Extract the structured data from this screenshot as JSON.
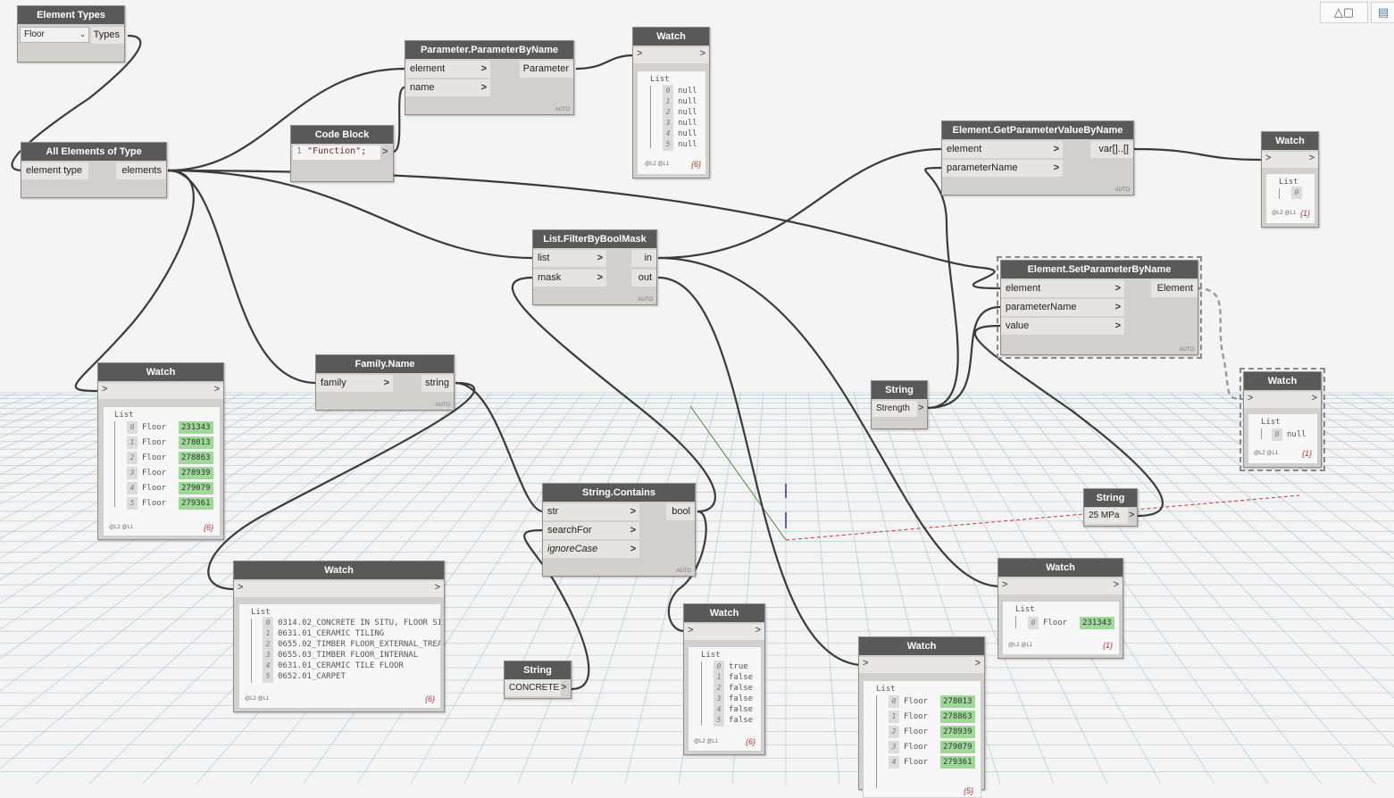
{
  "toolbar": {
    "view_3d_icon": "cube-icon",
    "layout_icon": "layout-icon"
  },
  "colors": {
    "node_header": "#595959",
    "node_body": "#d2d0cc",
    "wire": "#3a3a3a",
    "id_highlight": "#9ed99a",
    "grid": "#a9c3cf"
  },
  "nodes": {
    "element_types": {
      "title": "Element Types",
      "selected": "Floor",
      "output": "Types"
    },
    "all_elements": {
      "title": "All Elements of Type",
      "input": "element type",
      "output": "elements"
    },
    "param_by_name": {
      "title": "Parameter.ParameterByName",
      "in1": "element",
      "in2": "name",
      "output": "Parameter",
      "lacing": "AUTO"
    },
    "code_block": {
      "title": "Code Block",
      "line_no": "1",
      "code": "\"Function\";"
    },
    "watch_top": {
      "title": "Watch",
      "list_label": "List",
      "rows": [
        {
          "i": "0",
          "v": "null"
        },
        {
          "i": "1",
          "v": "null"
        },
        {
          "i": "2",
          "v": "null"
        },
        {
          "i": "3",
          "v": "null"
        },
        {
          "i": "4",
          "v": "null"
        },
        {
          "i": "5",
          "v": "null"
        }
      ],
      "levels": "@L2 @L1",
      "count": "{6}"
    },
    "get_param_value": {
      "title": "Element.GetParameterValueByName",
      "in1": "element",
      "in2": "parameterName",
      "output": "var[]..[]",
      "lacing": "AUTO"
    },
    "watch_right_top": {
      "title": "Watch",
      "list_label": "List",
      "rows": [
        {
          "i": "0",
          "v": ""
        }
      ],
      "levels": "@L2 @L1",
      "count": "{1}"
    },
    "filter_mask": {
      "title": "List.FilterByBoolMask",
      "in1": "list",
      "in2": "mask",
      "out1": "in",
      "out2": "out",
      "lacing": "AUTO"
    },
    "set_param": {
      "title": "Element.SetParameterByName",
      "in1": "element",
      "in2": "parameterName",
      "in3": "value",
      "output": "Element",
      "lacing": "AUTO"
    },
    "watch_left": {
      "title": "Watch",
      "list_label": "List",
      "rows": [
        {
          "i": "0",
          "t": "Floor",
          "id": "231343"
        },
        {
          "i": "1",
          "t": "Floor",
          "id": "278013"
        },
        {
          "i": "2",
          "t": "Floor",
          "id": "278863"
        },
        {
          "i": "3",
          "t": "Floor",
          "id": "278939"
        },
        {
          "i": "4",
          "t": "Floor",
          "id": "279079"
        },
        {
          "i": "5",
          "t": "Floor",
          "id": "279361"
        }
      ],
      "levels": "@L2 @L1",
      "count": "{6}"
    },
    "family_name": {
      "title": "Family.Name",
      "input": "family",
      "output": "string",
      "lacing": "AUTO"
    },
    "string_strength": {
      "title": "String",
      "value": "Strength"
    },
    "watch_null": {
      "title": "Watch",
      "list_label": "List",
      "rows": [
        {
          "i": "0",
          "v": "null"
        }
      ],
      "levels": "@L2 @L1",
      "count": "{1}"
    },
    "string_contains": {
      "title": "String.Contains",
      "in1": "str",
      "in2": "searchFor",
      "in3": "ignoreCase",
      "output": "bool",
      "lacing": "AUTO"
    },
    "string_mpa": {
      "title": "String",
      "value": "25 MPa"
    },
    "watch_names": {
      "title": "Watch",
      "list_label": "List",
      "rows": [
        {
          "i": "0",
          "v": "0314.02_CONCRETE IN SITU, FLOOR SI"
        },
        {
          "i": "1",
          "v": "0631.01_CERAMIC TILING"
        },
        {
          "i": "2",
          "v": "0655.02_TIMBER FLOOR_EXTERNAL_TREA"
        },
        {
          "i": "3",
          "v": "0655.03_TIMBER FLOOR_INTERNAL"
        },
        {
          "i": "4",
          "v": "0631.01_CERAMIC TILE FLOOR"
        },
        {
          "i": "5",
          "v": "0652.01_CARPET"
        }
      ],
      "levels": "@L2 @L1",
      "count": "{6}"
    },
    "string_concrete": {
      "title": "String",
      "value": "CONCRETE"
    },
    "watch_bool": {
      "title": "Watch",
      "list_label": "List",
      "rows": [
        {
          "i": "0",
          "v": "true"
        },
        {
          "i": "1",
          "v": "false"
        },
        {
          "i": "2",
          "v": "false"
        },
        {
          "i": "3",
          "v": "false"
        },
        {
          "i": "4",
          "v": "false"
        },
        {
          "i": "5",
          "v": "false"
        }
      ],
      "levels": "@L2 @L1",
      "count": "{6}"
    },
    "watch_in": {
      "title": "Watch",
      "list_label": "List",
      "rows": [
        {
          "i": "0",
          "t": "Floor",
          "id": "231343"
        }
      ],
      "levels": "@L2 @L1",
      "count": "{1}"
    },
    "watch_out": {
      "title": "Watch",
      "list_label": "List",
      "rows": [
        {
          "i": "0",
          "t": "Floor",
          "id": "278013"
        },
        {
          "i": "1",
          "t": "Floor",
          "id": "278863"
        },
        {
          "i": "2",
          "t": "Floor",
          "id": "278939"
        },
        {
          "i": "3",
          "t": "Floor",
          "id": "279079"
        },
        {
          "i": "4",
          "t": "Floor",
          "id": "279361"
        }
      ],
      "count": "{5}"
    }
  }
}
